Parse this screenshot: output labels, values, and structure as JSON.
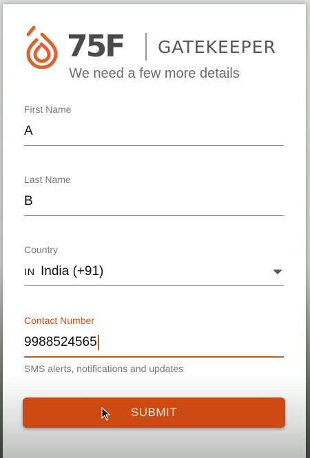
{
  "brand": {
    "name": "75F",
    "product": "GATEKEEPER",
    "accent": "#d0541c"
  },
  "form": {
    "subtitle": "We need a few more details",
    "first_name": {
      "label": "First Name",
      "value": "A"
    },
    "last_name": {
      "label": "Last Name",
      "value": "B"
    },
    "country": {
      "label": "Country",
      "flag_code": "IN",
      "value": "India (+91)"
    },
    "contact": {
      "label": "Contact Number",
      "value": "9988524565",
      "helper": "SMS alerts, notifications and updates"
    },
    "submit_label": "SUBMIT"
  },
  "icons": [
    "75f-logo-icon",
    "dropdown-arrow-icon",
    "mouse-cursor-icon"
  ]
}
